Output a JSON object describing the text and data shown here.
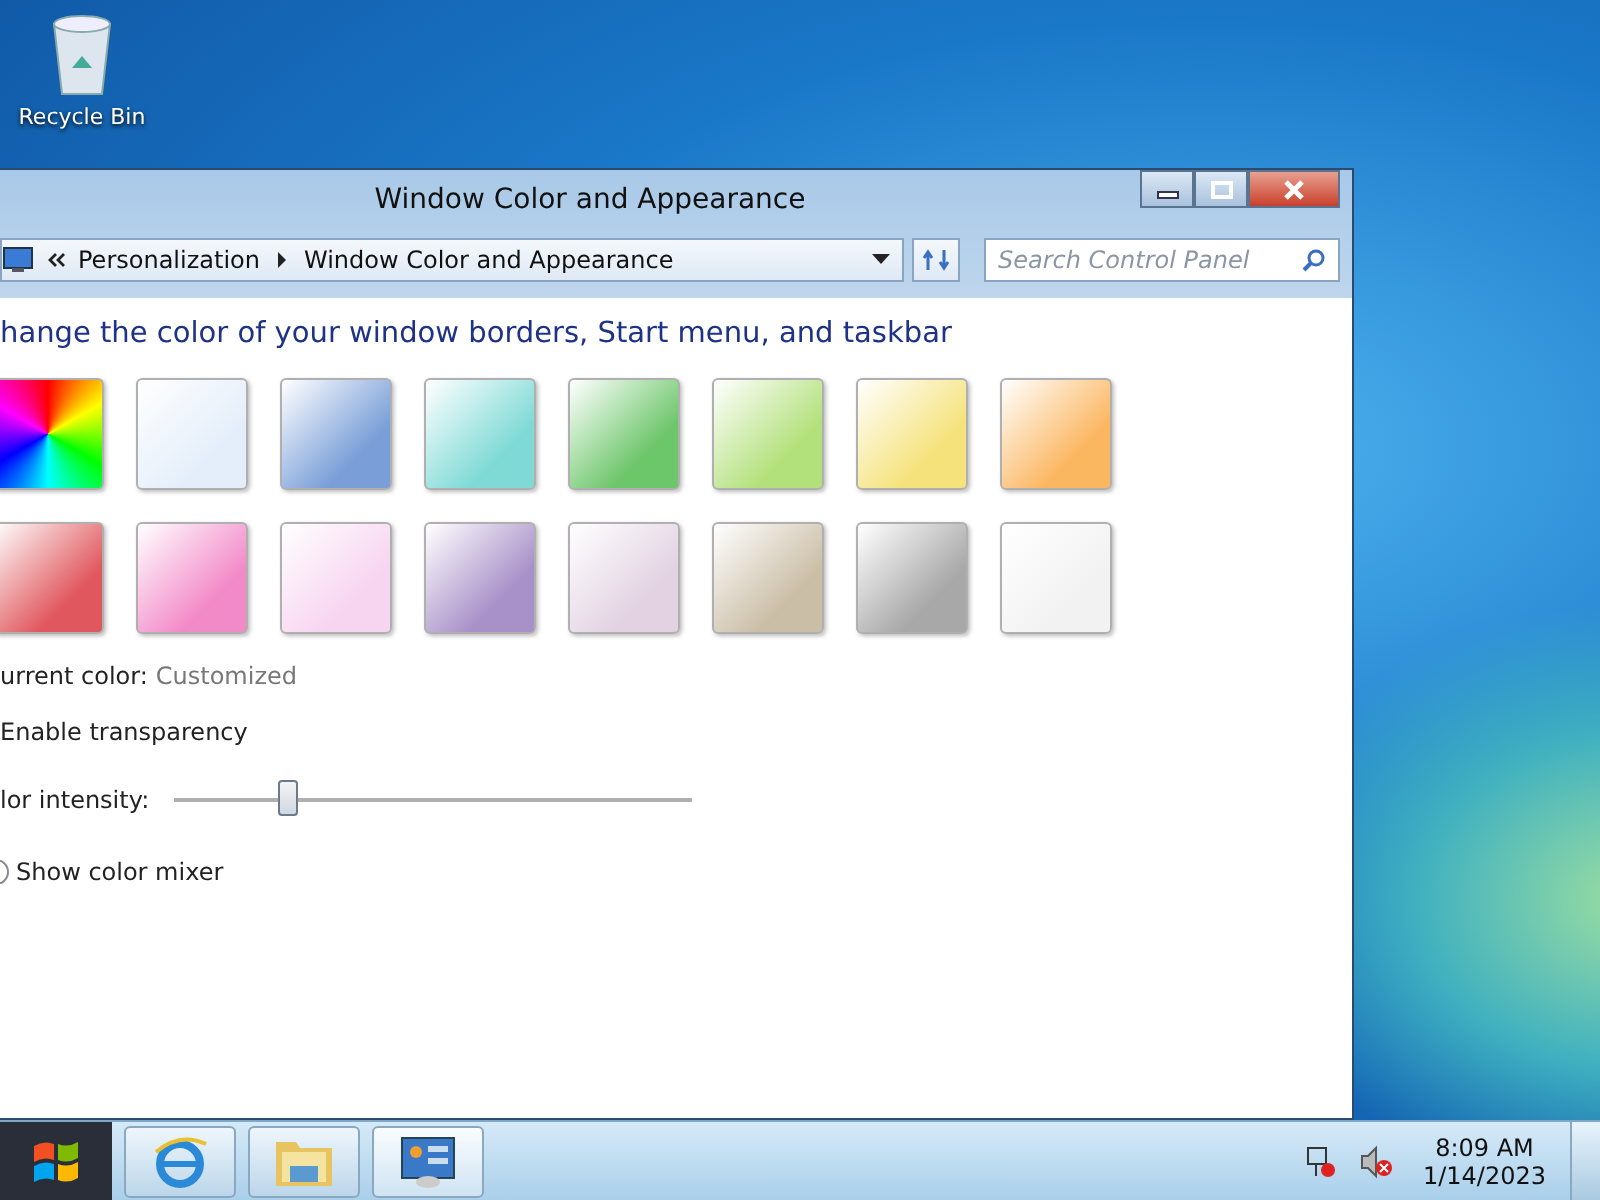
{
  "desktop": {
    "icons": [
      {
        "label": "Recycle Bin"
      }
    ]
  },
  "window": {
    "title": "Window Color and Appearance",
    "breadcrumb": [
      {
        "label": "Personalization"
      },
      {
        "label": "Window Color and Appearance"
      }
    ],
    "search": {
      "placeholder": "Search Control Panel"
    },
    "heading": "hange the color of your window borders, Start menu, and taskbar",
    "swatches": [
      {
        "kind": "rainbow"
      },
      {
        "kind": "plain",
        "color": "#e4eefa"
      },
      {
        "kind": "plain",
        "color": "#7a9fd8"
      },
      {
        "kind": "plain",
        "color": "#7fdad6"
      },
      {
        "kind": "plain",
        "color": "#6cc66a"
      },
      {
        "kind": "plain",
        "color": "#b2e07a"
      },
      {
        "kind": "plain",
        "color": "#f5e27a"
      },
      {
        "kind": "plain",
        "color": "#fbb660"
      },
      {
        "kind": "plain",
        "color": "#e0585e"
      },
      {
        "kind": "plain",
        "color": "#f28ac8"
      },
      {
        "kind": "plain",
        "color": "#f7d4f0"
      },
      {
        "kind": "plain",
        "color": "#a890c8"
      },
      {
        "kind": "plain",
        "color": "#e2d2e2"
      },
      {
        "kind": "plain",
        "color": "#cabea6"
      },
      {
        "kind": "plain",
        "color": "#a8a8a8"
      },
      {
        "kind": "plain",
        "color": "#f2f2f2"
      }
    ],
    "current_color": {
      "label": "urrent color:",
      "value": "Customized"
    },
    "transparency": {
      "label": "Enable transparency"
    },
    "intensity": {
      "label": "lor intensity:",
      "level": 0.22
    },
    "color_mixer": {
      "label": "Show color mixer"
    }
  },
  "taskbar": {
    "clock": {
      "time": "8:09 AM",
      "date": "1/14/2023"
    }
  }
}
